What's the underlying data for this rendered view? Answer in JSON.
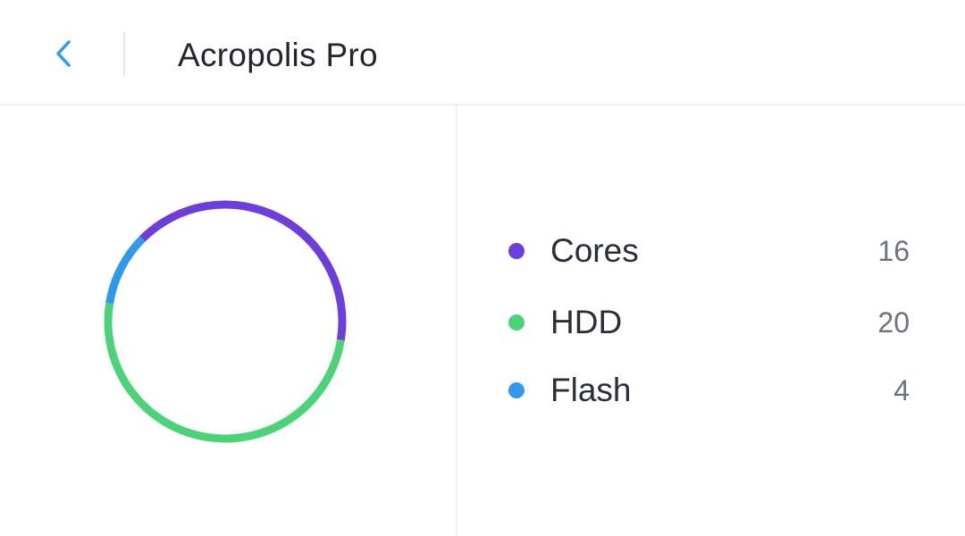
{
  "header": {
    "title": "Acropolis Pro",
    "back_icon": "chevron-left-icon",
    "accent_color": "#2d9cf0"
  },
  "chart_data": {
    "type": "pie",
    "style": "donut",
    "categories": [
      "Cores",
      "HDD",
      "Flash"
    ],
    "values": [
      16,
      20,
      4
    ],
    "colors": [
      "#6c3edb",
      "#4cd37a",
      "#3099ee"
    ],
    "title": ""
  },
  "legend": {
    "items": [
      {
        "label": "Cores",
        "value": "16",
        "color": "#6c3edb"
      },
      {
        "label": "HDD",
        "value": "20",
        "color": "#4cd37a"
      },
      {
        "label": "Flash",
        "value": "4",
        "color": "#3099ee"
      }
    ]
  }
}
